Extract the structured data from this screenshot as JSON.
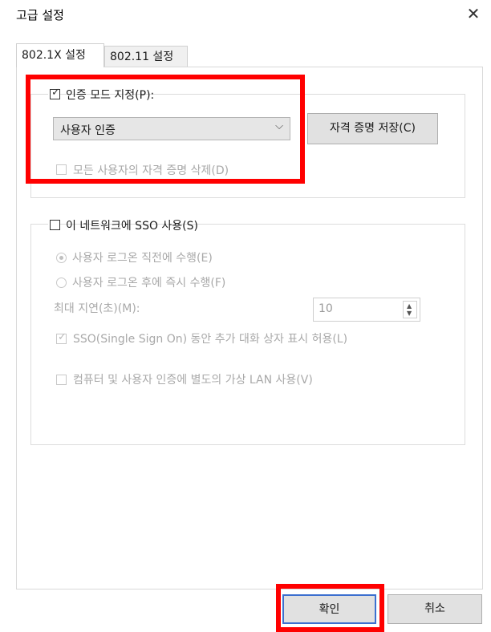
{
  "window": {
    "title": "고급 설정",
    "close_glyph": "✕"
  },
  "tabs": [
    {
      "label": "802.1X 설정",
      "selected": true
    },
    {
      "label": "802.11 설정",
      "selected": false
    }
  ],
  "auth_group": {
    "checkbox_label": "인증 모드 지정(P):",
    "checked": true,
    "mode_value": "사용자 인증",
    "save_credentials_label": "자격 증명 저장(C)",
    "delete_all_label": "모든 사용자의 자격 증명 삭제(D)"
  },
  "sso_group": {
    "checkbox_label": "이 네트워크에 SSO 사용(S)",
    "radio_before_label": "사용자 로그온 직전에 수행(E)",
    "radio_after_label": "사용자 로그온 후에 즉시 수행(F)",
    "max_delay_label": "최대 지연(초)(M):",
    "max_delay_value": "10",
    "allow_dialogs_label": "SSO(Single Sign On) 동안 추가 대화 상자 표시 허용(L)",
    "separate_vlan_label": "컴퓨터 및 사용자 인증에 별도의 가상 LAN 사용(V)"
  },
  "footer": {
    "ok_label": "확인",
    "cancel_label": "취소"
  },
  "colors": {
    "highlight": "#ff0000",
    "default_button_border": "#3c6fcf"
  }
}
